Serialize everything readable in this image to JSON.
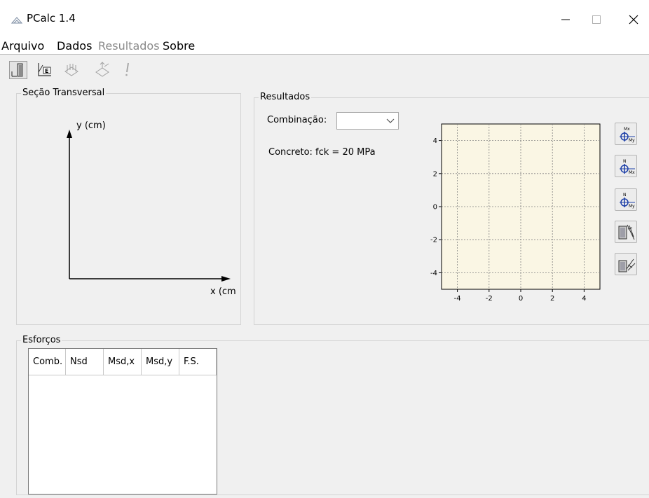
{
  "window": {
    "title": "PCalc 1.4"
  },
  "menu": {
    "arquivo": "Arquivo",
    "dados": "Dados",
    "resultados": "Resultados",
    "sobre": "Sobre"
  },
  "toolbar": {
    "icons": [
      "section-geometry-icon",
      "material-diagram-icon",
      "reinforcement-icon",
      "forces-icon",
      "warning-icon"
    ]
  },
  "secao": {
    "title": "Seção Transversal",
    "y_axis_label": "y (cm)",
    "x_axis_label": "x (cm"
  },
  "resultados": {
    "title": "Resultados",
    "combinacao_label": "Combinação:",
    "combinacao_value": "",
    "concreto": "Concreto: fck = 20 MPa"
  },
  "side_buttons": {
    "b1_top": "Mx",
    "b1_bottom": "My",
    "b2_top": "N",
    "b2_bottom": "Mx",
    "b3_top": "N",
    "b3_bottom": "My"
  },
  "esforcos": {
    "title": "Esforços",
    "columns": [
      "Comb.",
      "Nsd",
      "Msd,x",
      "Msd,y",
      "F.S."
    ],
    "rows": []
  },
  "chart_data": {
    "type": "scatter",
    "title": "",
    "xlabel": "",
    "ylabel": "",
    "xlim": [
      -5,
      5
    ],
    "ylim": [
      -5,
      5
    ],
    "x_ticks": [
      -4,
      -2,
      0,
      2,
      4
    ],
    "y_ticks": [
      -4,
      -2,
      0,
      2,
      4
    ],
    "series": [],
    "grid": true,
    "background": "#faf6e4"
  },
  "colors": {
    "plot_background": "#faf6e4",
    "grid": "#808080"
  }
}
